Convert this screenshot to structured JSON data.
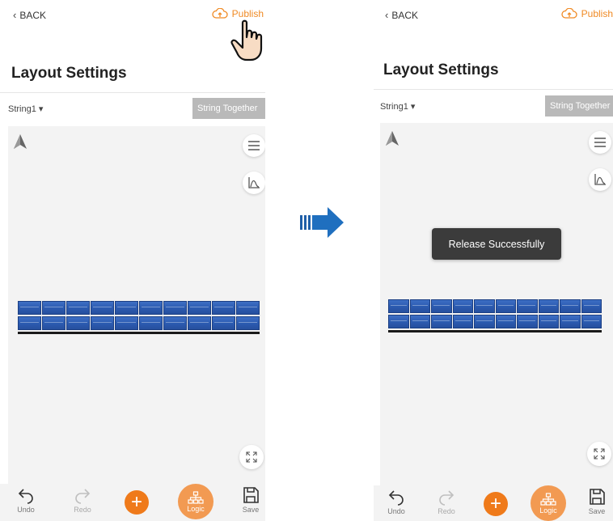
{
  "colors": {
    "accent": "#f08a24",
    "panel": "#2d5db3",
    "disabled_button": "#b9b9b9",
    "toast": "#3b3b3b"
  },
  "left_screen": {
    "back_label": "BACK",
    "publish_label": "Publish",
    "title": "Layout Settings",
    "string_select": "String1 ▾",
    "string_together_label": "String Together",
    "toolbar": {
      "undo": "Undo",
      "redo": "Redo",
      "logic": "Logic",
      "save": "Save"
    },
    "panel_rows": 2,
    "panels_per_row": 10
  },
  "right_screen": {
    "back_label": "BACK",
    "publish_label": "Publish",
    "title": "Layout Settings",
    "string_select": "String1 ▾",
    "string_together_label": "String Together",
    "toast": "Release Successfully",
    "toolbar": {
      "undo": "Undo",
      "redo": "Redo",
      "logic": "Logic",
      "save": "Save"
    },
    "panel_rows": 2,
    "panels_per_row": 10
  },
  "icons": [
    "chevron-left-icon",
    "cloud-upload-icon",
    "north-arrow-icon",
    "list-icon",
    "chart-icon",
    "expand-icon",
    "undo-icon",
    "redo-icon",
    "plus-icon",
    "logic-tree-icon",
    "save-icon",
    "hand-pointer-icon",
    "right-arrow-icon"
  ]
}
